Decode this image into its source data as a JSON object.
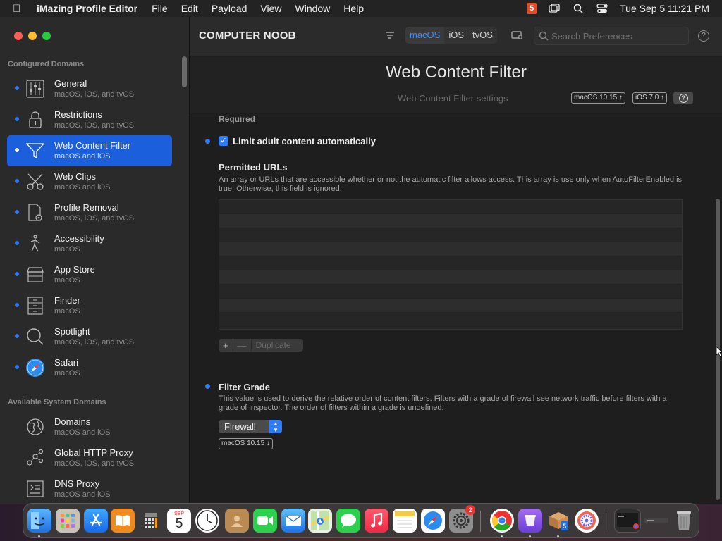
{
  "menubar": {
    "app_name": "iMazing Profile Editor",
    "items": [
      "File",
      "Edit",
      "Payload",
      "View",
      "Window",
      "Help"
    ],
    "clock": "Tue Sep 5  11:21 PM"
  },
  "sidebar": {
    "configured_heading": "Configured Domains",
    "configured": [
      {
        "title": "General",
        "subtitle": "macOS, iOS, and tvOS",
        "icon": "sliders-icon"
      },
      {
        "title": "Restrictions",
        "subtitle": "macOS, iOS, and tvOS",
        "icon": "lock-icon"
      },
      {
        "title": "Web Content Filter",
        "subtitle": "macOS and iOS",
        "icon": "funnel-icon"
      },
      {
        "title": "Web Clips",
        "subtitle": "macOS and iOS",
        "icon": "scissors-icon"
      },
      {
        "title": "Profile Removal",
        "subtitle": "macOS, iOS, and tvOS",
        "icon": "document-gear-icon"
      },
      {
        "title": "Accessibility",
        "subtitle": "macOS",
        "icon": "figure-icon"
      },
      {
        "title": "App Store",
        "subtitle": "macOS",
        "icon": "store-icon"
      },
      {
        "title": "Finder",
        "subtitle": "macOS",
        "icon": "cabinet-icon"
      },
      {
        "title": "Spotlight",
        "subtitle": "macOS, iOS, and tvOS",
        "icon": "magnifier-icon"
      },
      {
        "title": "Safari",
        "subtitle": "macOS",
        "icon": "compass-icon"
      }
    ],
    "available_heading": "Available System Domains",
    "available": [
      {
        "title": "Domains",
        "subtitle": "macOS and iOS",
        "icon": "globe-icon"
      },
      {
        "title": "Global HTTP Proxy",
        "subtitle": "macOS, iOS, and tvOS",
        "icon": "nodes-icon"
      },
      {
        "title": "DNS Proxy",
        "subtitle": "macOS and iOS",
        "icon": "dns-icon"
      }
    ]
  },
  "toolbar": {
    "title": "COMPUTER NOOB",
    "segments": [
      "macOS",
      "iOS",
      "tvOS"
    ],
    "search_placeholder": "Search Preferences"
  },
  "header": {
    "title": "Web Content Filter",
    "subtitle": "Web Content Filter settings",
    "badge_macos": "macOS  10.15",
    "badge_ios": "iOS  7.0"
  },
  "content": {
    "required_label": "Required",
    "checkbox_label": "Limit adult content automatically",
    "permitted_title": "Permitted URLs",
    "permitted_desc": "An array or URLs that are accessible whether or not the automatic filter allows access. This array is use only when AutoFilterEnabled is true. Otherwise, this field is ignored.",
    "duplicate_label": "Duplicate",
    "filter_title": "Filter Grade",
    "filter_desc": "This value is used to derive the relative order of content filters. Filters with a grade of firewall see network traffic before filters with a grade of inspector. The order of filters within a grade is undefined.",
    "filter_value": "Firewall",
    "filter_badge": "macOS  10.15"
  },
  "dock": {
    "calendar_month": "SEP",
    "calendar_day": "5",
    "settings_badge": "2",
    "html5_glyph": "5"
  },
  "colors": {
    "accent": "#1c5fdc",
    "dot": "#2f7cf6"
  }
}
